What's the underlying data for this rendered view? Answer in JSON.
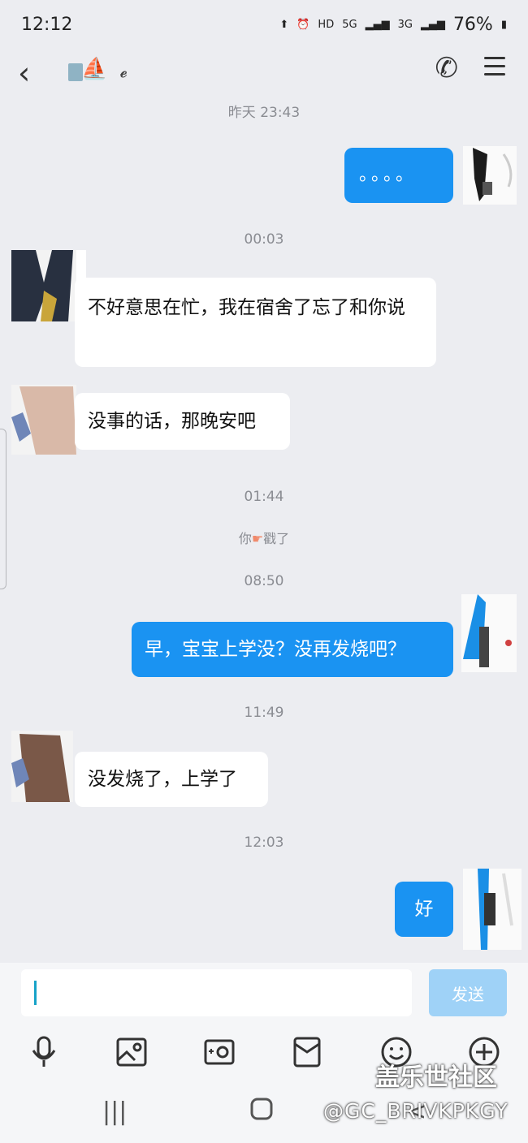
{
  "status_bar": {
    "time": "12:12",
    "hd": "HD",
    "net1": "5G",
    "net2": "3G",
    "battery": "76%"
  },
  "header": {
    "back_icon": "chevron-left-icon",
    "ear_icon": "ear-icon",
    "phone_icon": "phone-icon",
    "menu_icon": "menu-icon"
  },
  "timestamps": {
    "t1": "昨天 23:43",
    "t2": "00:03",
    "t3": "01:44",
    "t4": "08:50",
    "t5": "11:49",
    "t6": "12:03"
  },
  "messages": {
    "m1": "。。。。",
    "m2": "不好意思在忙，我在宿舍了忘了和你说",
    "m3": "没事的话，那晚安吧",
    "m4": "早，宝宝上学没？没再发烧吧？",
    "m5": "没发烧了，上学了",
    "m6": "好"
  },
  "system_message": {
    "you": "你",
    "action": "戳了"
  },
  "input": {
    "placeholder": "",
    "send_label": "发送"
  },
  "watermark": {
    "line1": "盖乐世社区",
    "line2": "@GC_BRIVKPKGY"
  },
  "colors": {
    "background": "#ecedf1",
    "outgoing_bubble": "#1a93f2",
    "incoming_bubble": "#ffffff",
    "send_button": "#9fd2f7"
  }
}
